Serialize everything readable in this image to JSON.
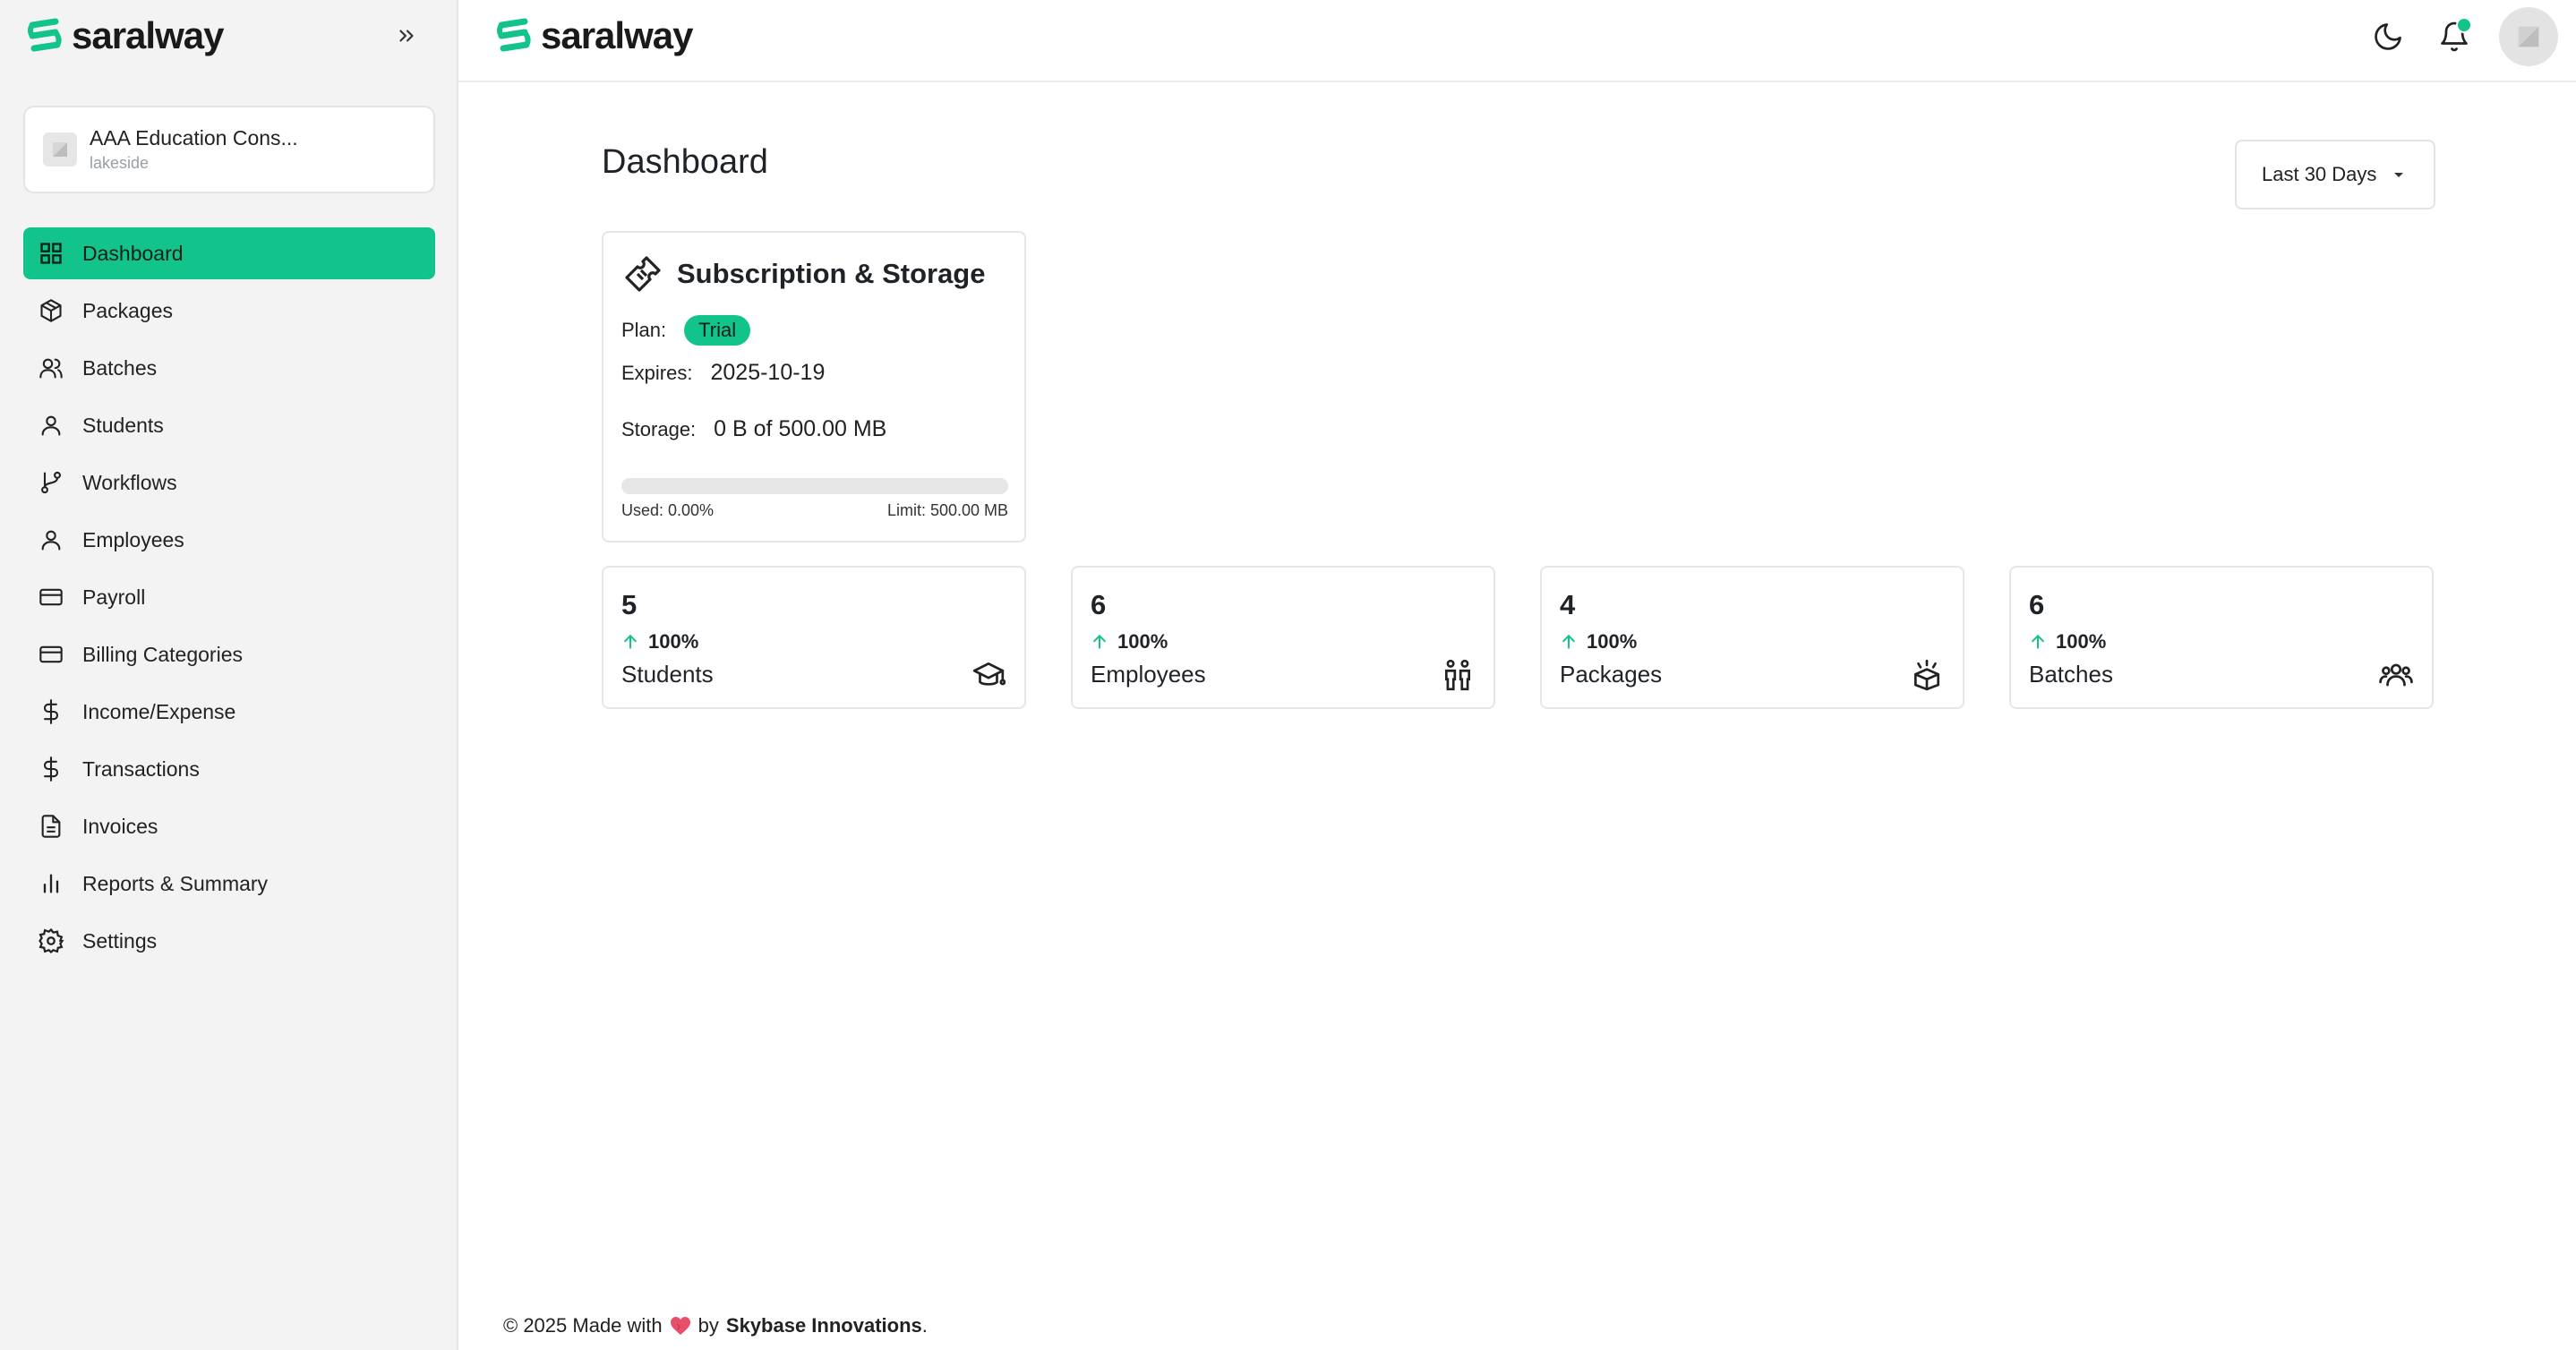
{
  "app": {
    "brand_name": "saralway",
    "brand_color": "#12c48b"
  },
  "sidebar": {
    "org": {
      "name": "AAA Education Cons...",
      "location": "lakeside"
    },
    "items": [
      {
        "label": "Dashboard",
        "icon": "grid-icon",
        "active": true
      },
      {
        "label": "Packages",
        "icon": "package-icon"
      },
      {
        "label": "Batches",
        "icon": "users-icon"
      },
      {
        "label": "Students",
        "icon": "user-icon"
      },
      {
        "label": "Workflows",
        "icon": "git-branch-icon"
      },
      {
        "label": "Employees",
        "icon": "user-icon"
      },
      {
        "label": "Payroll",
        "icon": "credit-card-icon"
      },
      {
        "label": "Billing Categories",
        "icon": "credit-card-icon"
      },
      {
        "label": "Income/Expense",
        "icon": "dollar-icon"
      },
      {
        "label": "Transactions",
        "icon": "dollar-icon"
      },
      {
        "label": "Invoices",
        "icon": "file-text-icon"
      },
      {
        "label": "Reports & Summary",
        "icon": "bar-chart-icon"
      },
      {
        "label": "Settings",
        "icon": "gear-icon"
      }
    ]
  },
  "main": {
    "title": "Dashboard",
    "date_range": {
      "selected": "Last 30 Days"
    },
    "subscription": {
      "title": "Subscription & Storage",
      "plan_label": "Plan:",
      "plan_value": "Trial",
      "expires_label": "Expires:",
      "expires_value": "2025-10-19",
      "storage_label": "Storage:",
      "storage_value": "0 B of 500.00 MB",
      "used_fraction": 0.0,
      "used_label": "Used: 0.00%",
      "limit_label": "Limit: 500.00 MB"
    },
    "stats": [
      {
        "value": "5",
        "change": "100%",
        "label": "Students",
        "icon": "graduation-cap-icon"
      },
      {
        "value": "6",
        "change": "100%",
        "label": "Employees",
        "icon": "people-icon"
      },
      {
        "value": "4",
        "change": "100%",
        "label": "Packages",
        "icon": "package-open-icon"
      },
      {
        "value": "6",
        "change": "100%",
        "label": "Batches",
        "icon": "group-icon"
      }
    ]
  },
  "footer": {
    "prefix": "© 2025 Made with",
    "by": "by",
    "company": "Skybase Innovations",
    "suffix": "."
  }
}
